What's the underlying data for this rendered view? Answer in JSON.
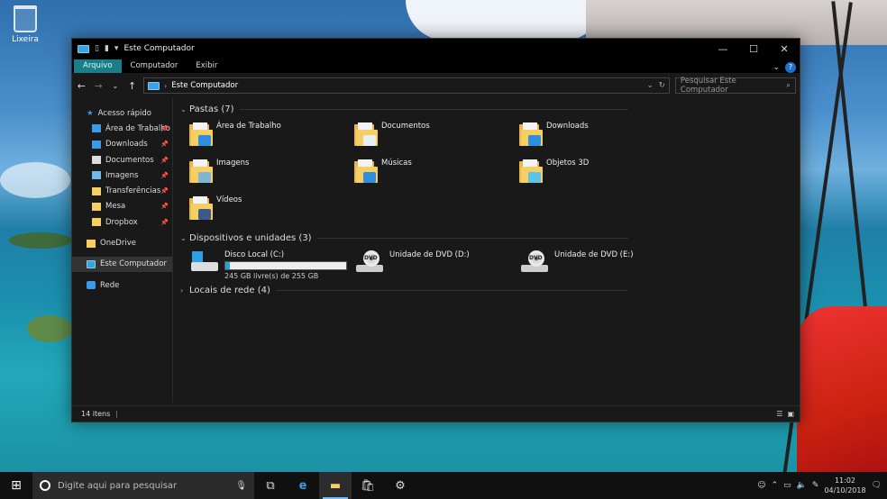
{
  "desktop": {
    "recycle_bin_label": "Lixeira"
  },
  "window": {
    "title": "Este Computador",
    "controls": {
      "minimize": "—",
      "maximize": "☐",
      "close": "✕"
    },
    "ribbon_tabs": [
      {
        "label": "Arquivo",
        "active": true
      },
      {
        "label": "Computador",
        "active": false
      },
      {
        "label": "Exibir",
        "active": false
      }
    ],
    "address": {
      "path": "Este Computador",
      "search_placeholder": "Pesquisar Este Computador"
    },
    "sidebar": {
      "quick_access": "Acesso rápido",
      "pinned": [
        {
          "label": "Área de Trabalho",
          "icon": "desktop-icon",
          "color": "#3a9be8"
        },
        {
          "label": "Downloads",
          "icon": "download-icon",
          "color": "#3a9be8"
        },
        {
          "label": "Documentos",
          "icon": "document-icon",
          "color": "#dddddd"
        },
        {
          "label": "Imagens",
          "icon": "image-icon",
          "color": "#6fb8e8"
        },
        {
          "label": "Transferências",
          "icon": "folder-icon",
          "color": "#f5cf63"
        },
        {
          "label": "Mesa",
          "icon": "folder-icon",
          "color": "#f5cf63"
        },
        {
          "label": "Dropbox",
          "icon": "folder-icon",
          "color": "#f5cf63"
        }
      ],
      "onedrive": "OneDrive",
      "this_pc": "Este Computador",
      "network": "Rede"
    },
    "sections": {
      "folders_title": "Pastas (7)",
      "devices_title": "Dispositivos e unidades (3)",
      "network_title": "Locais de rede (4)"
    },
    "folders": [
      {
        "label": "Área de Trabalho",
        "badge": "#2f8de0"
      },
      {
        "label": "Documentos",
        "badge": "#e9eef5"
      },
      {
        "label": "Downloads",
        "badge": "#2f8de0"
      },
      {
        "label": "Imagens",
        "badge": "#7fb6d8"
      },
      {
        "label": "Músicas",
        "badge": "#2f8de0"
      },
      {
        "label": "Objetos 3D",
        "badge": "#5bc4e8"
      },
      {
        "label": "Vídeos",
        "badge": "#3c5a88"
      }
    ],
    "drives": {
      "local": {
        "label": "Disco Local (C:)",
        "free": "245 GB livre(s) de 255 GB",
        "used_fraction": 0.04
      },
      "dvd_d": {
        "label": "Unidade de DVD (D:)",
        "badge": "DVD"
      },
      "dvd_e": {
        "label": "Unidade de DVD (E:)",
        "badge": "DVD"
      }
    },
    "status": {
      "items": "14 itens"
    }
  },
  "taskbar": {
    "search_placeholder": "Digite aqui para pesquisar",
    "time": "11:02",
    "date": "04/10/2018"
  }
}
